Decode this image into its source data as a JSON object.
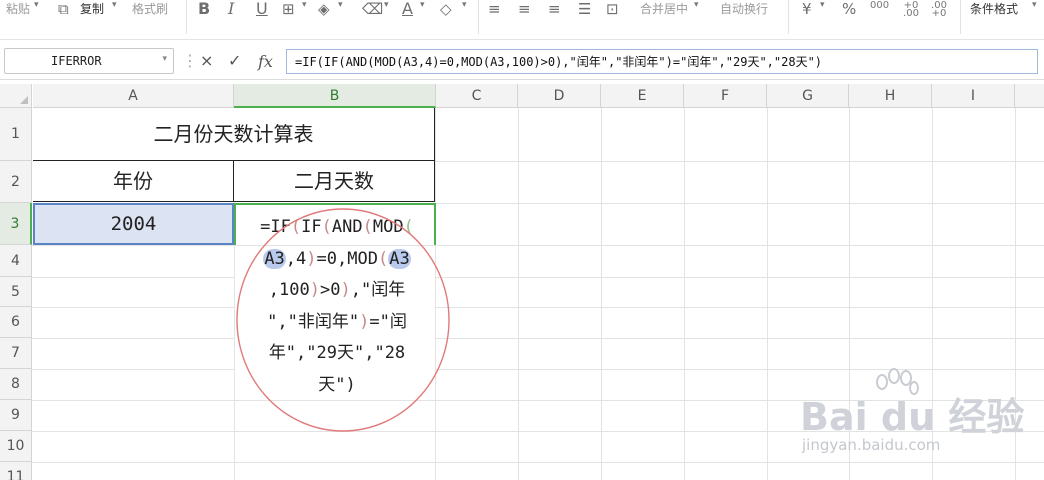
{
  "ribbon": {
    "paste_label": "粘贴",
    "copy_label": "复制",
    "format_painter_label": "格式刷",
    "bold_label": "B",
    "italic_label": "I",
    "underline_label": "U",
    "font_color_label": "A",
    "merge_center_label": "合并居中",
    "wrap_text_label": "自动换行",
    "currency_label": "¥",
    "percent_label": "%",
    "thousands_label": "000",
    "inc_decimal_label": "+0 .00",
    "dec_decimal_label": ".00 +0",
    "conditional_format_label": "条件格式",
    "icons": [
      "paste-icon",
      "copy-icon",
      "format-painter-icon",
      "border-icon",
      "fill-color-icon",
      "font-color-icon",
      "clear-icon",
      "align-left-icon",
      "align-center-icon",
      "align-right-icon",
      "justify-icon",
      "merge-icon",
      "currency-icon",
      "percent-icon"
    ]
  },
  "formula_bar": {
    "name_box": "IFERROR",
    "cancel_icon": "×",
    "enter_icon": "✓",
    "fx_label": "fx",
    "formula": "=IF(IF(AND(MOD(A3,4)=0,MOD(A3,100)>0),\"闰年\",\"非闰年\")=\"闰年\",\"29天\",\"28天\")"
  },
  "sheet": {
    "columns": [
      "A",
      "B",
      "C",
      "D",
      "E",
      "F",
      "G",
      "H",
      "I"
    ],
    "rows": [
      "1",
      "2",
      "3",
      "4",
      "5",
      "6",
      "7",
      "8",
      "9",
      "10",
      "11"
    ],
    "active_column": "B",
    "active_row": "3"
  },
  "cells": {
    "title": "二月份天数计算表",
    "header_year": "年份",
    "header_days": "二月天数",
    "a3_value": "2004"
  },
  "edit_overlay": {
    "line1_a": "=IF",
    "line1_b": "(",
    "line1_c": "IF",
    "line1_d": "(",
    "line1_e": "AND",
    "line1_f": "(",
    "line1_g": "MOD",
    "line1_h": "(",
    "line2_ref": "A3",
    "line2_b": ",4",
    "line2_c": ")",
    "line2_d": "=0,MOD",
    "line2_e": "(",
    "line2_ref2": "A3",
    "line3_a": ",100",
    "line3_b": ")",
    "line3_c": ">0",
    "line3_d": ")",
    "line3_e": ",\"闰年",
    "line4_a": "\",\"非闰年\"",
    "line4_b": ")",
    "line4_c": "=\"闰",
    "line5": "年\",\"29天\",\"28",
    "line6_a": "天\"",
    "line6_b": ")"
  },
  "watermark": {
    "logo": "Bai du 经验",
    "url": "jingyan.baidu.com"
  },
  "colors": {
    "active_green": "#4caf50",
    "selected_blue": "#5b84c7",
    "ref_highlight": "#b8c9ec",
    "annotation_red": "#e07a7a"
  }
}
